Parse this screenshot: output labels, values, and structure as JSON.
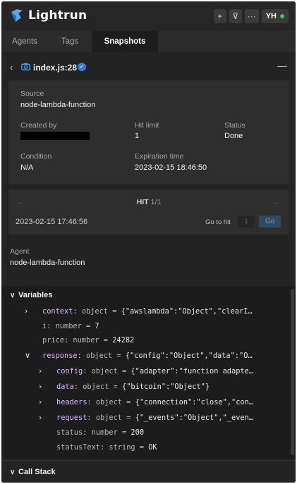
{
  "app": {
    "name": "Lightrun",
    "actions": [
      "+",
      "⊽",
      "···"
    ],
    "user_initials": "YH",
    "accent_blue": "#3a7bd5",
    "status_green": "#44c06a"
  },
  "tabs": [
    {
      "label": "Agents",
      "active": false
    },
    {
      "label": "Tags",
      "active": false
    },
    {
      "label": "Snapshots",
      "active": true
    }
  ],
  "snapshot": {
    "file": "index.js:28",
    "collapse_symbol": "—"
  },
  "info": {
    "source_label": "Source",
    "source_value": "node-lambda-function",
    "created_by_label": "Created by",
    "hit_limit_label": "Hit limit",
    "hit_limit_value": "1",
    "status_label": "Status",
    "status_value": "Done",
    "condition_label": "Condition",
    "condition_value": "N/A",
    "expiration_label": "Expiration time",
    "expiration_value": "2023-02-15 18:46:50"
  },
  "hit": {
    "label": "HIT",
    "count": "1/1",
    "date": "2023-02-15 17:46:56",
    "goto_label": "Go to hit",
    "goto_value": "1",
    "go_button": "Go"
  },
  "agent": {
    "label": "Agent",
    "value": "node-lambda-function"
  },
  "variables": {
    "title": "Variables",
    "rows": [
      {
        "key": "context",
        "type": "object",
        "value": "{\"awslambda\":\"Object\",\"clearI…",
        "expandable": true
      },
      {
        "key": "i",
        "type": "number",
        "value": "7",
        "expandable": false
      },
      {
        "key": "price",
        "type": "number",
        "value": "24282",
        "expandable": false
      },
      {
        "key": "response",
        "type": "object",
        "value": "{\"config\":\"Object\",\"data\":\"O…",
        "expandable": true
      },
      {
        "key": "config",
        "type": "object",
        "value": "{\"adapter\":\"function adapte…",
        "expandable": true
      },
      {
        "key": "data",
        "type": "object",
        "value": "{\"bitcoin\":\"Object\"}",
        "expandable": true
      },
      {
        "key": "headers",
        "type": "object",
        "value": "{\"connection\":\"close\",\"con…",
        "expandable": true
      },
      {
        "key": "request",
        "type": "object",
        "value": "{\"_events\":\"Object\",\"_even…",
        "expandable": true
      },
      {
        "key": "status",
        "type": "number",
        "value": "200",
        "expandable": false
      },
      {
        "key": "statusText",
        "type": "string",
        "value": "OK",
        "expandable": false
      }
    ]
  },
  "call_stack": {
    "title": "Call Stack"
  }
}
